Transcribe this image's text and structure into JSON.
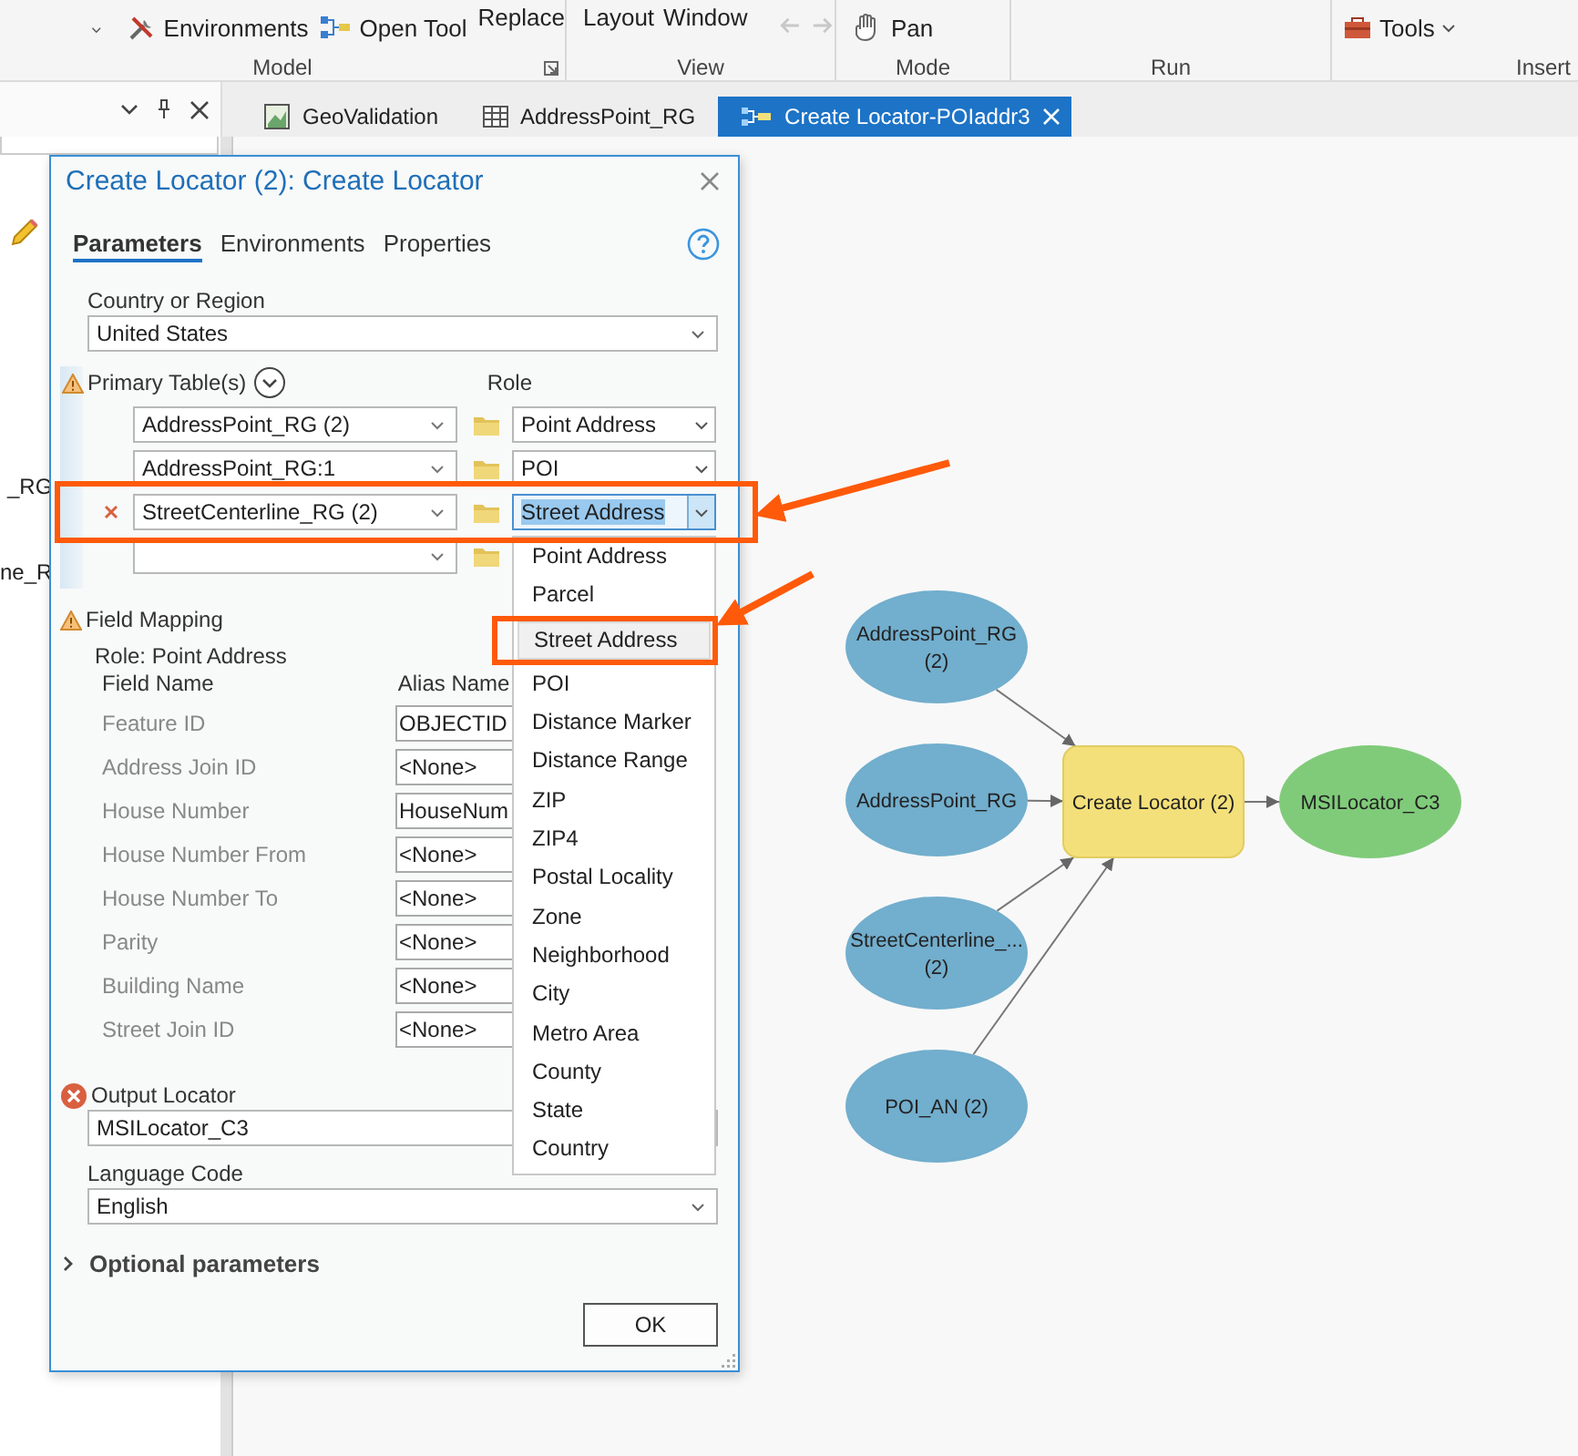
{
  "ribbon": {
    "environments": "Environments",
    "open_tool": "Open Tool",
    "replace": "Replace",
    "layout": "Layout",
    "window": "Window",
    "history_disabled": true,
    "pan": "Pan",
    "tools": "Tools",
    "groups": [
      "Model",
      "View",
      "Mode",
      "Run",
      "Insert"
    ]
  },
  "side_pane": {
    "fragments": [
      "_RG",
      "ne_R"
    ]
  },
  "doc_tabs": [
    {
      "kind": "map",
      "label": "GeoValidation",
      "selected": false
    },
    {
      "kind": "table",
      "label": "AddressPoint_RG",
      "selected": false
    },
    {
      "kind": "model",
      "label": "Create Locator-POIaddr3",
      "selected": true
    }
  ],
  "dialog": {
    "title": "Create Locator (2): Create Locator",
    "tabs": [
      {
        "label": "Parameters",
        "selected": true
      },
      {
        "label": "Environments",
        "selected": false
      },
      {
        "label": "Properties",
        "selected": false
      }
    ],
    "country": {
      "label": "Country or Region",
      "value": "United States"
    },
    "primary_tables": {
      "label": "Primary Table(s)",
      "warning": true,
      "role_label": "Role",
      "rows": [
        {
          "table": "AddressPoint_RG (2)",
          "role": "Point Address",
          "removable": false,
          "role_open": false,
          "callout": false
        },
        {
          "table": "AddressPoint_RG:1",
          "role": "POI",
          "removable": false,
          "role_open": false,
          "callout": false
        },
        {
          "table": "StreetCenterline_RG (2)",
          "role": "Street Address",
          "removable": true,
          "role_open": true,
          "callout": true,
          "options": [
            {
              "label": "Point Address",
              "selected": false,
              "callout": false
            },
            {
              "label": "Parcel",
              "selected": false,
              "callout": false
            },
            {
              "label": "Street Address",
              "selected": true,
              "callout": true
            },
            {
              "label": "POI",
              "selected": false,
              "callout": false
            },
            {
              "label": "Distance Marker",
              "selected": false,
              "callout": false
            },
            {
              "label": "Distance Range",
              "selected": false,
              "callout": false
            },
            {
              "label": "ZIP",
              "selected": false,
              "callout": false
            },
            {
              "label": "ZIP4",
              "selected": false,
              "callout": false
            },
            {
              "label": "Postal Locality",
              "selected": false,
              "callout": false
            },
            {
              "label": "Zone",
              "selected": false,
              "callout": false
            },
            {
              "label": "Neighborhood",
              "selected": false,
              "callout": false
            },
            {
              "label": "City",
              "selected": false,
              "callout": false
            },
            {
              "label": "Metro Area",
              "selected": false,
              "callout": false
            },
            {
              "label": "County",
              "selected": false,
              "callout": false
            },
            {
              "label": "State",
              "selected": false,
              "callout": false
            },
            {
              "label": "Country",
              "selected": false,
              "callout": false
            }
          ]
        },
        {
          "removable": false,
          "callout": false
        }
      ]
    },
    "field_mapping": {
      "label": "Field Mapping",
      "warning": true,
      "role": "Role: Point Address",
      "columns": [
        "Field Name",
        "Alias Name"
      ],
      "rows": [
        {
          "field": "Feature ID",
          "alias": "OBJECTID"
        },
        {
          "field": "Address Join ID",
          "alias": "<None>"
        },
        {
          "field": "House Number",
          "alias": "HouseNum"
        },
        {
          "field": "House Number From",
          "alias": "<None>"
        },
        {
          "field": "House Number To",
          "alias": "<None>"
        },
        {
          "field": "Parity",
          "alias": "<None>"
        },
        {
          "field": "Building Name",
          "alias": "<None>"
        },
        {
          "field": "Street Join ID",
          "alias": "<None>"
        }
      ]
    },
    "output": {
      "label": "Output Locator",
      "error": true,
      "value": "MSILocator_C3"
    },
    "language": {
      "label": "Language Code",
      "value": "English"
    },
    "optional": {
      "label": "Optional parameters",
      "expanded": false
    },
    "ok": "OK"
  },
  "model": {
    "nodes": [
      {
        "kind": "input",
        "lines": [
          "AddressPoint_RG",
          "(2)"
        ]
      },
      {
        "kind": "input",
        "lines": [
          "AddressPoint_RG"
        ]
      },
      {
        "kind": "input",
        "lines": [
          "StreetCenterline_...",
          "(2)"
        ]
      },
      {
        "kind": "input",
        "lines": [
          "POI_AN (2)"
        ]
      },
      {
        "kind": "tool",
        "lines": [
          "Create Locator (2)"
        ]
      },
      {
        "kind": "output",
        "lines": [
          "MSILocator_C3"
        ]
      }
    ]
  }
}
